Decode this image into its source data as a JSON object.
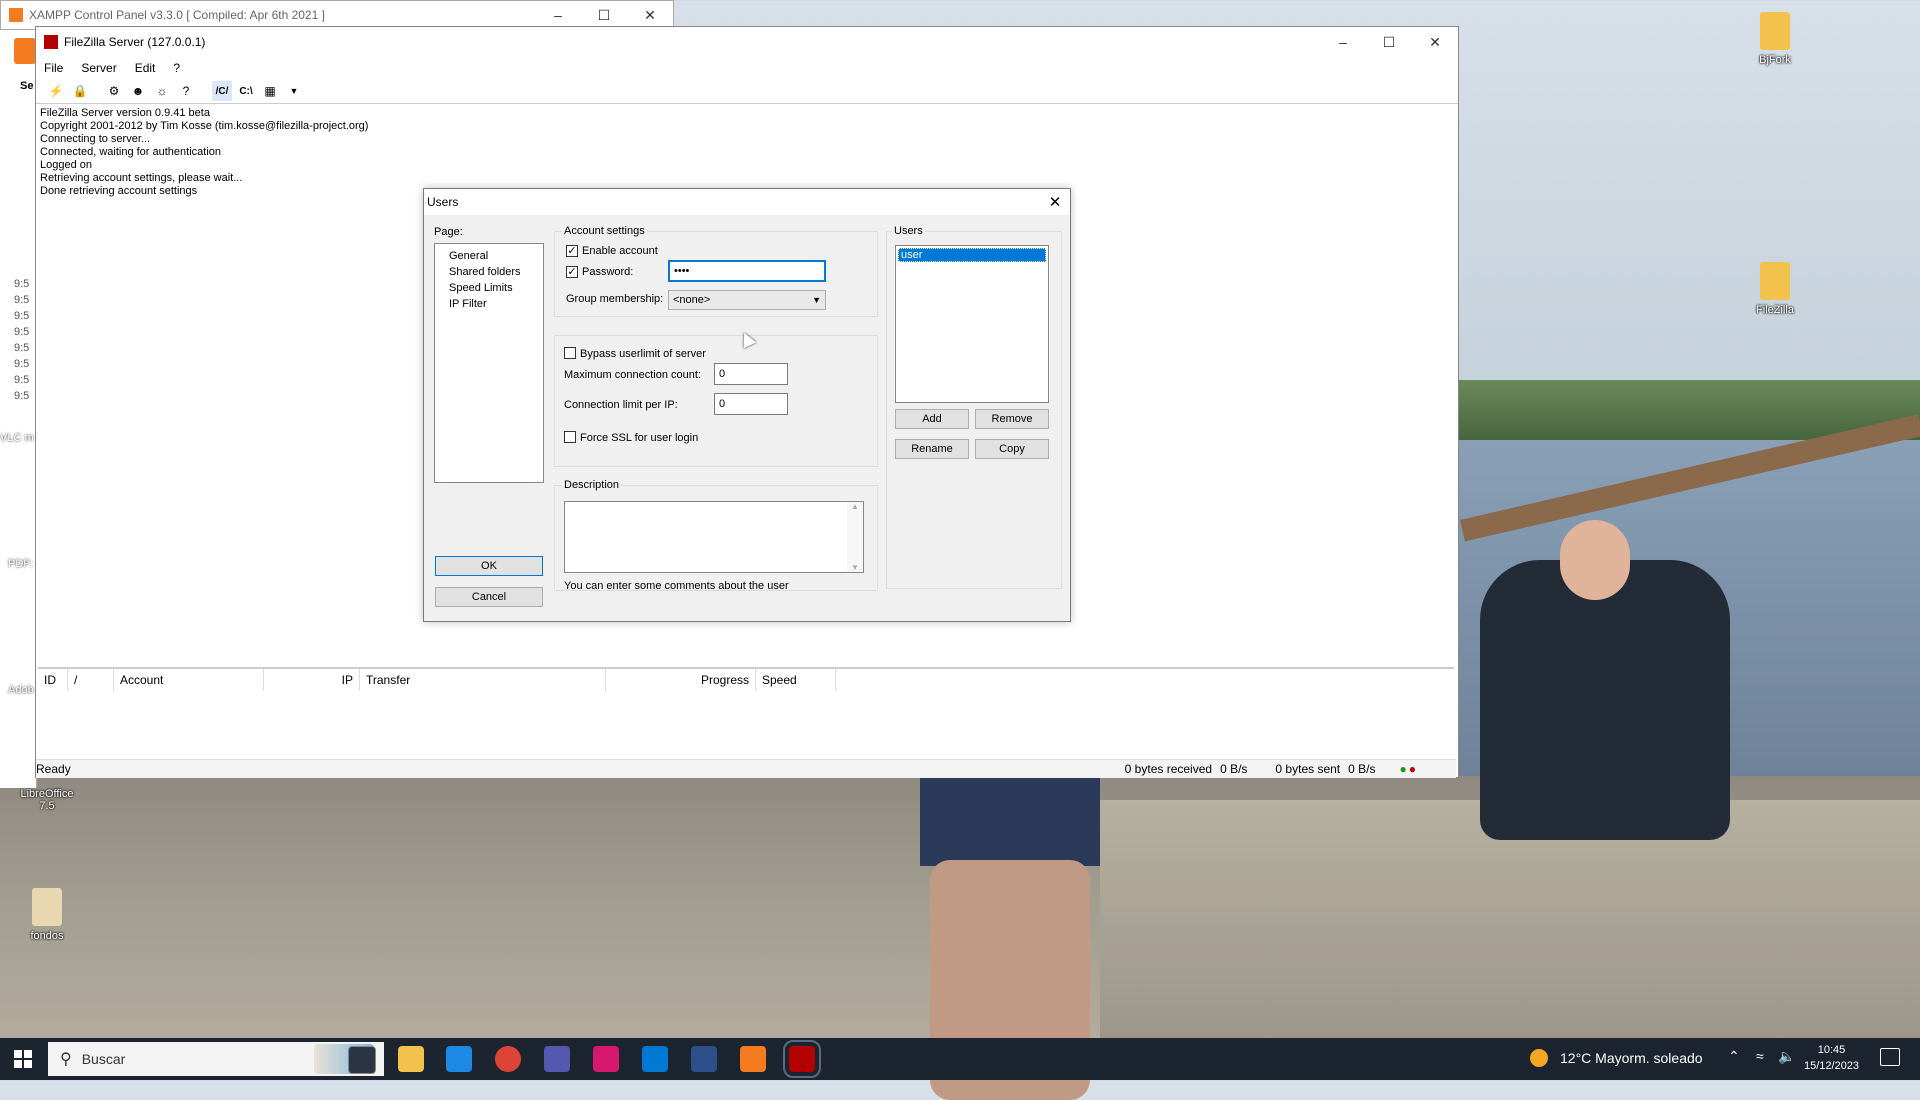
{
  "xampp": {
    "title": "XAMPP Control Panel v3.3.0   [ Compiled: Apr 6th 2021 ]"
  },
  "filezilla": {
    "title": "FileZilla Server (127.0.0.1)",
    "menu": [
      "File",
      "Server",
      "Edit",
      "?"
    ],
    "toolbar_text": [
      "/C/",
      "C:\\"
    ],
    "log": [
      "FileZilla Server version 0.9.41 beta",
      "Copyright 2001-2012 by Tim Kosse (tim.kosse@filezilla-project.org)",
      "Connecting to server...",
      "Connected, waiting for authentication",
      "Logged on",
      "Retrieving account settings, please wait...",
      "Done retrieving account settings"
    ],
    "columns": [
      "ID",
      "/",
      "Account",
      "IP",
      "Transfer",
      "Progress",
      "Speed"
    ],
    "status": {
      "left": "Ready",
      "received": "0 bytes received",
      "recv_rate": "0 B/s",
      "sent": "0 bytes sent",
      "sent_rate": "0 B/s"
    }
  },
  "dialog": {
    "title": "Users",
    "page_label": "Page:",
    "pages": [
      "General",
      "Shared folders",
      "Speed Limits",
      "IP Filter"
    ],
    "account_settings_label": "Account settings",
    "enable_account": "Enable account",
    "password_label": "Password:",
    "password_value": "••••",
    "group_label": "Group membership:",
    "group_value": "<none>",
    "bypass_label": "Bypass userlimit of server",
    "max_conn_label": "Maximum connection count:",
    "max_conn_value": "0",
    "conn_ip_label": "Connection limit per IP:",
    "conn_ip_value": "0",
    "force_ssl": "Force SSL for user login",
    "description_label": "Description",
    "description_hint": "You can enter some comments about the user",
    "users_label": "Users",
    "users": [
      "user"
    ],
    "add": "Add",
    "remove": "Remove",
    "rename": "Rename",
    "copy": "Copy",
    "ok": "OK",
    "cancel": "Cancel"
  },
  "desktop": {
    "icons": [
      "BjFork",
      "FileZilla",
      "LibreOffice 7.5",
      "fondos"
    ],
    "left_partial": [
      "Se",
      "VLC m",
      "PDF:",
      "Adob"
    ],
    "timestamps": [
      "9:5",
      "9:5",
      "9:5",
      "9:5",
      "9:5",
      "9:5",
      "9:5",
      "9:5"
    ]
  },
  "taskbar": {
    "search_placeholder": "Buscar",
    "weather": "12°C  Mayorm. soleado",
    "time": "10:45",
    "date": "15/12/2023"
  }
}
